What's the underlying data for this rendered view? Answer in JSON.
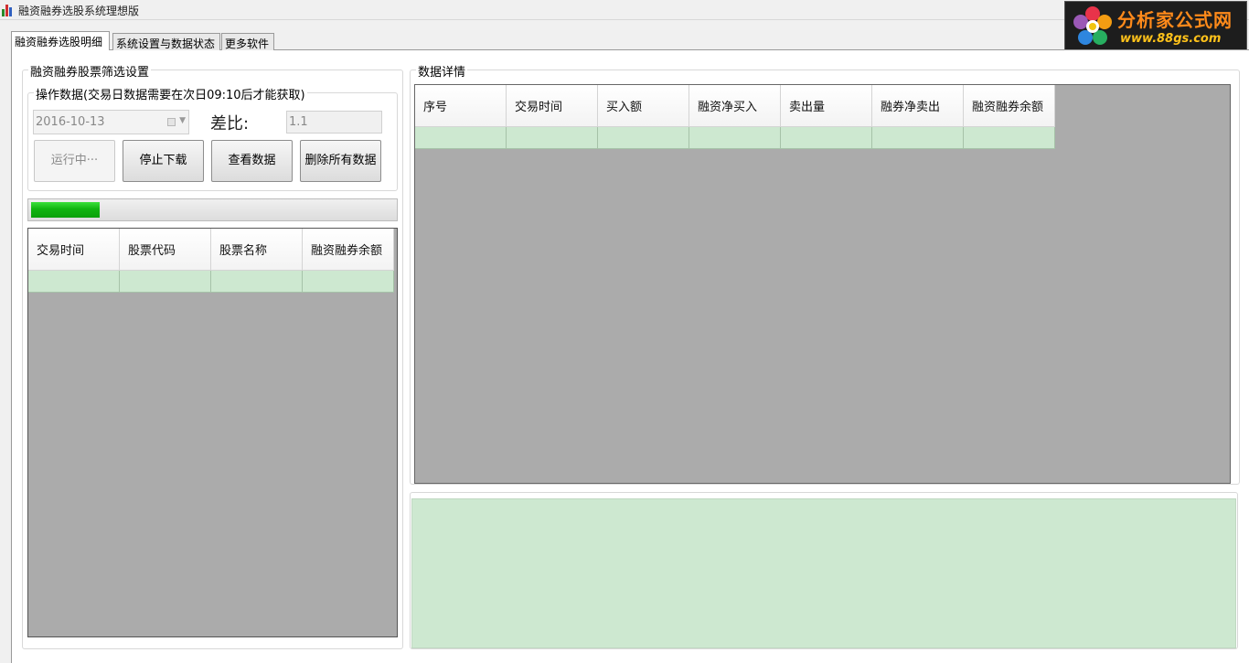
{
  "window": {
    "title": "融资融券选股系统理想版"
  },
  "logo": {
    "main_text": "分析家公式网",
    "url_text": "www.88gs.com"
  },
  "tabs": [
    {
      "label": "融资融券选股明细",
      "active": true
    },
    {
      "label": "系统设置与数据状态",
      "active": false
    },
    {
      "label": "更多软件",
      "active": false
    }
  ],
  "filter_group": {
    "label": "融资融券股票筛选设置",
    "operation_group": {
      "label": "操作数据(交易日数据需要在次日09:10后才能获取)",
      "date_value": "2016-10-13",
      "ratio_label": "差比:",
      "ratio_value": "1.1",
      "buttons": {
        "running": "运行中···",
        "stop_download": "停止下载",
        "view_data": "查看数据",
        "delete_all": "删除所有数据"
      }
    },
    "progress_fraction": 0.19
  },
  "stock_list": {
    "columns": [
      "交易时间",
      "股票代码",
      "股票名称",
      "融资融券余额"
    ]
  },
  "detail_group": {
    "label": "数据详情",
    "columns": [
      "序号",
      "交易时间",
      "买入额",
      "融资净买入",
      "卖出量",
      "融券净卖出",
      "融资融券余额"
    ]
  },
  "colors": {
    "grid_background": "#ababab",
    "selected_row": "#cde8d0",
    "progress_green": "#10b410"
  }
}
